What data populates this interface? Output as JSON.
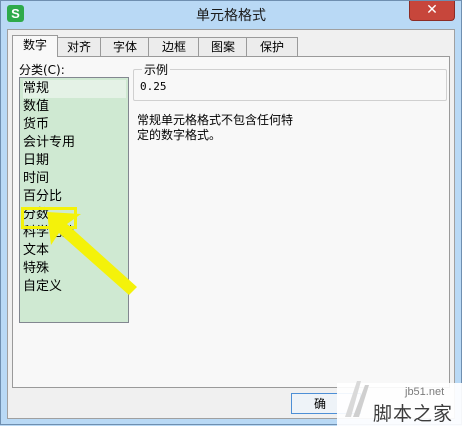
{
  "window": {
    "title": "单元格格式",
    "app_icon": "S"
  },
  "tabs": [
    {
      "label": "数字"
    },
    {
      "label": "对齐"
    },
    {
      "label": "字体"
    },
    {
      "label": "边框"
    },
    {
      "label": "图案"
    },
    {
      "label": "保护"
    }
  ],
  "category": {
    "label": "分类(C):",
    "items": [
      "常规",
      "数值",
      "货币",
      "会计专用",
      "日期",
      "时间",
      "百分比",
      "分数",
      "科学记数",
      "文本",
      "特殊",
      "自定义"
    ],
    "selected": "常规"
  },
  "sample": {
    "legend": "示例",
    "value": "0.25"
  },
  "description": "常规单元格格式不包含任何特定的数字格式。",
  "buttons": {
    "ok": "确"
  },
  "watermark": {
    "url": "jb51.net",
    "text": "脚本之家"
  },
  "annotation": {
    "highlight_color": "#f4f20a",
    "target": "百分比"
  }
}
